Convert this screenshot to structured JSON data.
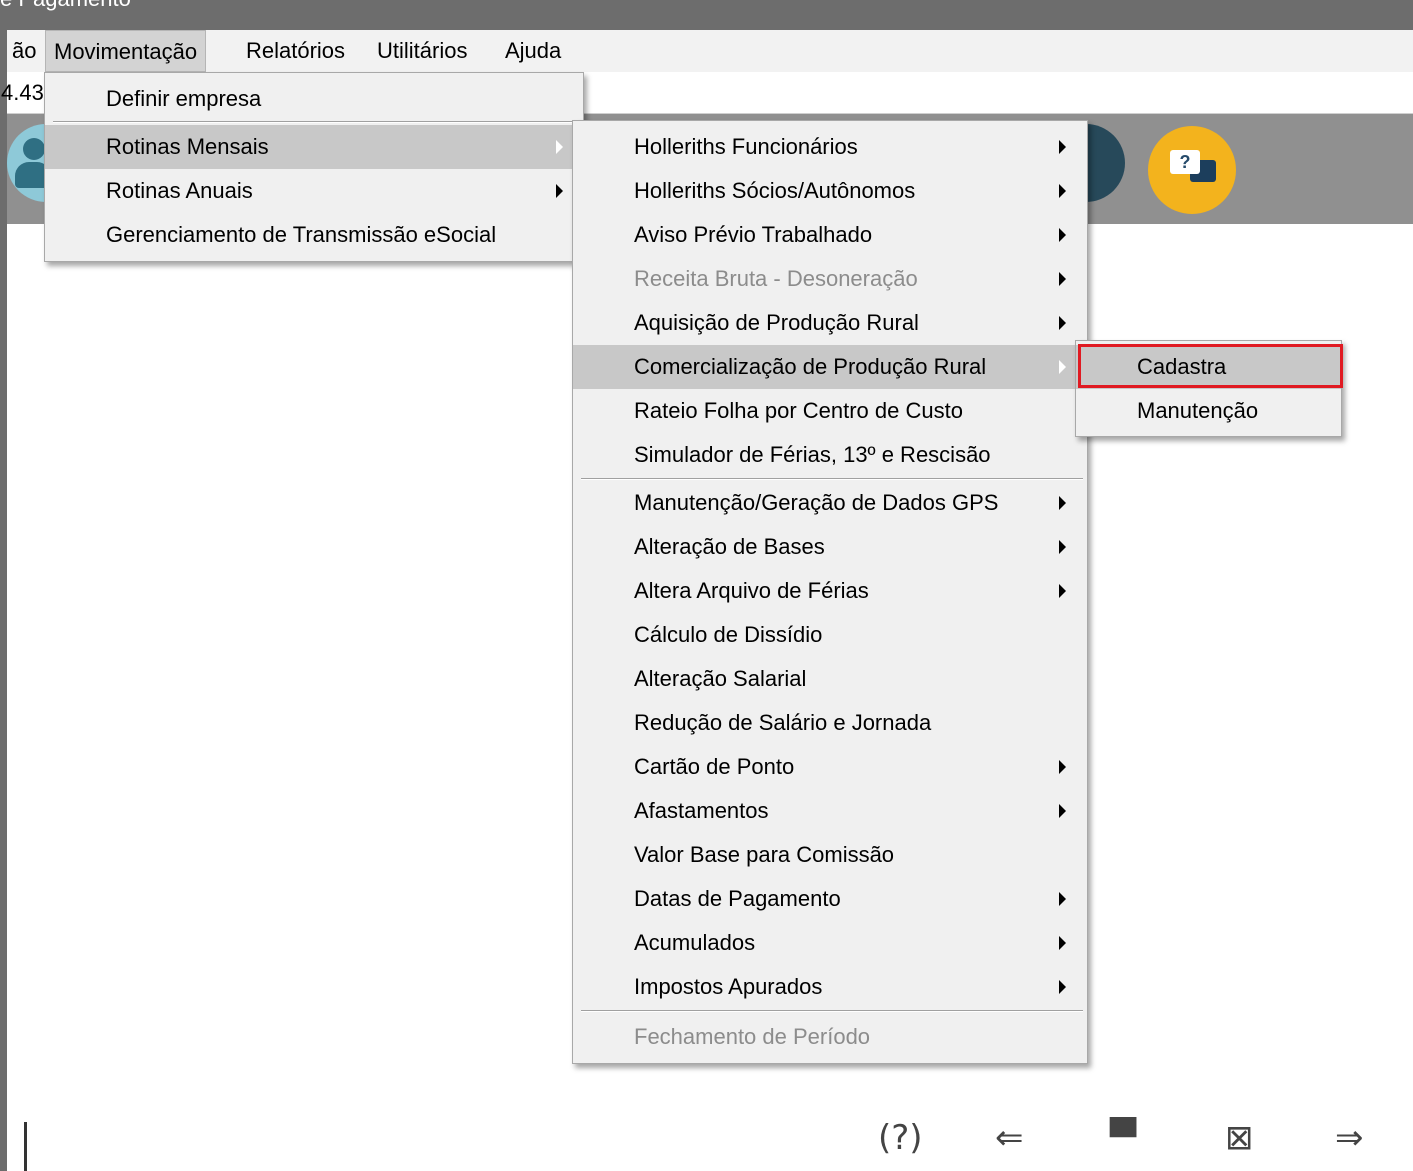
{
  "window": {
    "title": "e Pagamento"
  },
  "menubar": {
    "items": [
      {
        "label": "ão"
      },
      {
        "label": "Movimentação"
      },
      {
        "label": "Relatórios"
      },
      {
        "label": "Utilitários"
      },
      {
        "label": "Ajuda"
      }
    ]
  },
  "address": {
    "value": "4.43"
  },
  "movimentacao_menu": {
    "items": [
      {
        "label": "Definir empresa"
      },
      {
        "label": "Rotinas Mensais"
      },
      {
        "label": "Rotinas Anuais"
      },
      {
        "label": "Gerenciamento de Transmissão eSocial"
      }
    ]
  },
  "rotinas_mensais_menu": {
    "items": [
      {
        "label": "Holleriths Funcionários"
      },
      {
        "label": "Holleriths Sócios/Autônomos"
      },
      {
        "label": "Aviso Prévio Trabalhado"
      },
      {
        "label": "Receita Bruta - Desoneração"
      },
      {
        "label": "Aquisição de Produção Rural"
      },
      {
        "label": "Comercialização de Produção Rural"
      },
      {
        "label": "Rateio Folha por Centro de Custo"
      },
      {
        "label": "Simulador de Férias, 13º e Rescisão"
      },
      {
        "label": "Manutenção/Geração de Dados GPS"
      },
      {
        "label": "Alteração de Bases"
      },
      {
        "label": "Altera Arquivo de Férias"
      },
      {
        "label": "Cálculo de Dissídio"
      },
      {
        "label": "Alteração Salarial"
      },
      {
        "label": "Redução de Salário e Jornada"
      },
      {
        "label": "Cartão de Ponto"
      },
      {
        "label": "Afastamentos"
      },
      {
        "label": "Valor Base para Comissão"
      },
      {
        "label": "Datas de Pagamento"
      },
      {
        "label": "Acumulados"
      },
      {
        "label": "Impostos Apurados"
      },
      {
        "label": "Fechamento de Período"
      }
    ]
  },
  "comercializacao_menu": {
    "items": [
      {
        "label": "Cadastra"
      },
      {
        "label": "Manutenção"
      }
    ]
  },
  "toolbar": {
    "help_icon_text": "?"
  },
  "bottom_bar": {
    "icons": [
      {
        "glyph": "(?)"
      },
      {
        "glyph": "⇐"
      },
      {
        "glyph": "▀"
      },
      {
        "glyph": "⊠"
      },
      {
        "glyph": "⇒"
      }
    ]
  }
}
